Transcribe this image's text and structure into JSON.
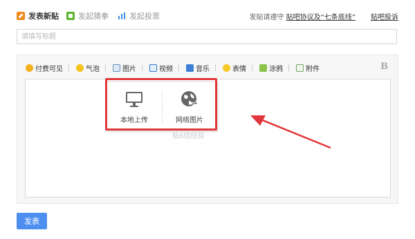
{
  "header": {
    "tabs": [
      {
        "label": "发表新贴"
      },
      {
        "label": "发起猜拳"
      },
      {
        "label": "发起投票"
      }
    ],
    "notice_prefix": "发贴请遵守",
    "notice_link": "贴吧协议及“七条底线”",
    "report_link": "贴吧投诉"
  },
  "title_input": {
    "placeholder": "请填写标题",
    "value": ""
  },
  "toolbar": {
    "items": [
      {
        "label": "付费可见",
        "icon": "coin-icon"
      },
      {
        "label": "气泡",
        "icon": "bubble-icon"
      },
      {
        "label": "图片",
        "icon": "image-icon"
      },
      {
        "label": "视频",
        "icon": "video-icon"
      },
      {
        "label": "音乐",
        "icon": "music-icon"
      },
      {
        "label": "表情",
        "icon": "emoji-icon"
      },
      {
        "label": "涂鸦",
        "icon": "doodle-icon"
      },
      {
        "label": "附件",
        "icon": "attachment-icon"
      }
    ],
    "bold": "B"
  },
  "content": {
    "hint": "贴6倍经验"
  },
  "image_popup": {
    "local_upload": "本地上传",
    "web_image": "网络图片"
  },
  "submit_label": "发表",
  "colors": {
    "accent": "#4d8ff0",
    "highlight": "#e0373a"
  }
}
